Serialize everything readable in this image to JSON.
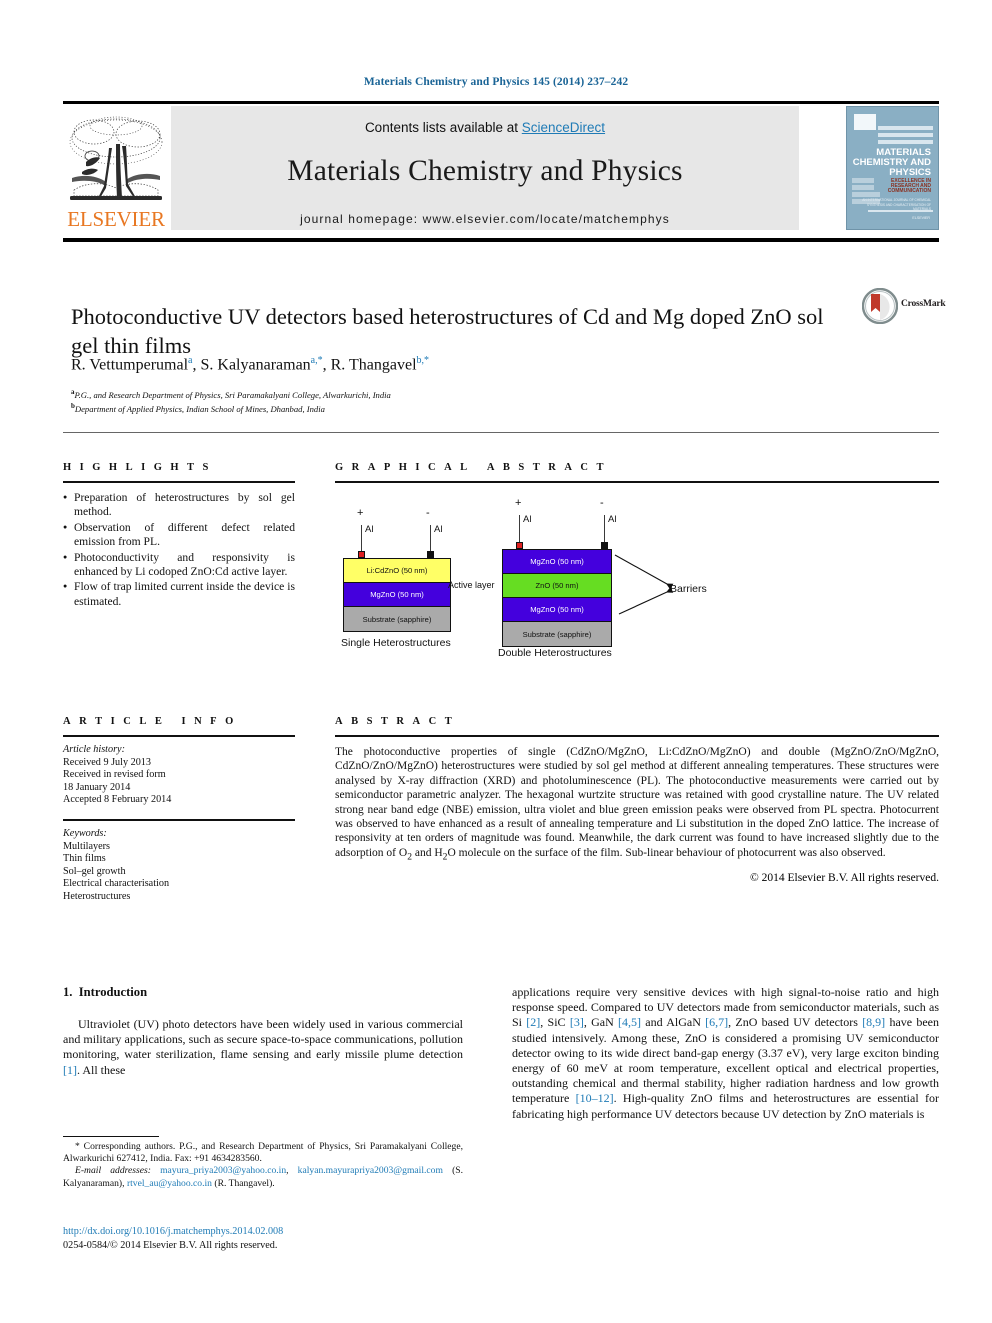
{
  "running_head": "Materials Chemistry and Physics 145 (2014) 237–242",
  "banner": {
    "contents_prefix": "Contents lists available at ",
    "sciencedirect": "ScienceDirect",
    "journal_title": "Materials Chemistry and Physics",
    "homepage": "journal homepage: www.elsevier.com/locate/matchemphys",
    "publisher_wordmark": "ELSEVIER",
    "cover": {
      "title_line1": "MATERIALS",
      "title_line2": "CHEMISTRY AND",
      "title_line3": "PHYSICS",
      "sub_line1": "EXCELLENCE IN",
      "sub_line2": "RESEARCH AND",
      "sub_line3": "COMMUNICATION",
      "tiny_line1": "AN INTERNATIONAL JOURNAL OF CHEMICAL",
      "tiny_line2": "SYNTHESIS AND CHARACTERISATION OF MATERIALS",
      "foot": "ELSEVIER"
    }
  },
  "article": {
    "title": "Photoconductive UV detectors based heterostructures of Cd and Mg doped ZnO sol gel thin films",
    "crossmark_label": "CrossMark",
    "authors": [
      {
        "name": "R. Vettumperumal",
        "marks": "a"
      },
      {
        "name": "S. Kalyanaraman",
        "marks": "a,*"
      },
      {
        "name": "R. Thangavel",
        "marks": "b,*"
      }
    ],
    "affiliations": [
      {
        "mark": "a",
        "text": "P.G., and Research Department of Physics, Sri Paramakalyani College, Alwarkurichi, India"
      },
      {
        "mark": "b",
        "text": "Department of Applied Physics, Indian School of Mines, Dhanbad, India"
      }
    ]
  },
  "highlights": {
    "heading": "HIGHLIGHTS",
    "items": [
      "Preparation of heterostructures by sol gel method.",
      "Observation of different defect related emission from PL.",
      "Photoconductivity and responsivity is enhanced by Li codoped ZnO:Cd active layer.",
      "Flow of trap limited current inside the device is estimated."
    ]
  },
  "graphical_abstract": {
    "heading": "GRAPHICAL ABSTRACT",
    "single": {
      "caption": "Single Heterostructures",
      "plus": "+",
      "minus": "-",
      "electrode_label": "Al",
      "layers": [
        {
          "label": "Li:CdZnO (50 nm)",
          "color": "#ffff66"
        },
        {
          "label": "MgZnO (50 nm)",
          "color": "#4400dd"
        },
        {
          "label": "Substrate (sapphire)",
          "color": "#aaaaaa"
        }
      ]
    },
    "double": {
      "caption": "Double Heterostructures",
      "plus": "+",
      "minus": "-",
      "electrode_label": "Al",
      "active_layer_label": "Active layer",
      "barriers_label": "Barriers",
      "layers": [
        {
          "label": "MgZnO (50 nm)",
          "color": "#4400dd"
        },
        {
          "label": "ZnO (50 nm)",
          "color": "#66dd22"
        },
        {
          "label": "MgZnO (50 nm)",
          "color": "#4400dd"
        },
        {
          "label": "Substrate (sapphire)",
          "color": "#aaaaaa"
        }
      ]
    }
  },
  "article_info": {
    "heading": "ARTICLE INFO",
    "history_label": "Article history:",
    "history": [
      "Received 9 July 2013",
      "Received in revised form",
      "18 January 2014",
      "Accepted 8 February 2014"
    ],
    "keywords_label": "Keywords:",
    "keywords": [
      "Multilayers",
      "Thin films",
      "Sol–gel growth",
      "Electrical characterisation",
      "Heterostructures"
    ]
  },
  "abstract": {
    "heading": "ABSTRACT",
    "text": "The photoconductive properties of single (CdZnO/MgZnO, Li:CdZnO/MgZnO) and double (MgZnO/ZnO/MgZnO, CdZnO/ZnO/MgZnO) heterostructures were studied by sol gel method at different annealing temperatures. These structures were analysed by X-ray diffraction (XRD) and photoluminescence (PL). The photoconductive measurements were carried out by semiconductor parametric analyzer. The hexagonal wurtzite structure was retained with good crystalline nature. The UV related strong near band edge (NBE) emission, ultra violet and blue green emission peaks were observed from PL spectra. Photocurrent was observed to have enhanced as a result of annealing temperature and Li substitution in the doped ZnO lattice. The increase of responsivity at ten orders of magnitude was found. Meanwhile, the dark current was found to have increased slightly due to the adsorption of O2 and H2O molecule on the surface of the film. Sub-linear behaviour of photocurrent was also observed.",
    "copyright": "© 2014 Elsevier B.V. All rights reserved."
  },
  "body": {
    "section_number": "1.",
    "section_title": "Introduction",
    "left_paragraph": "Ultraviolet (UV) photo detectors have been widely used in various commercial and military applications, such as secure space-to-space communications, pollution monitoring, water sterilization, flame sensing and early missile plume detection [1]. All these",
    "right_paragraph": "applications require very sensitive devices with high signal-to-noise ratio and high response speed. Compared to UV detectors made from semiconductor materials, such as Si [2], SiC [3], GaN [4,5] and AlGaN [6,7], ZnO based UV detectors [8,9] have been studied intensively. Among these, ZnO is considered a promising UV semiconductor detector owing to its wide direct band-gap energy (3.37 eV), very large exciton binding energy of 60 meV at room temperature, excellent optical and electrical properties, outstanding chemical and thermal stability, higher radiation hardness and low growth temperature [10–12]. High-quality ZnO films and heterostructures are essential for fabricating high performance UV detectors because UV detection by ZnO materials is"
  },
  "footnote": {
    "corresponding": "* Corresponding authors. P.G., and Research Department of Physics, Sri Paramakalyani College, Alwarkurichi 627412, India. Fax: +91 4634283560.",
    "email_label": "E-mail addresses:",
    "email1": "mayura_priya2003@yahoo.co.in",
    "email2": "kalyan.mayurapriya2003@gmail.com",
    "email2_owner": "(S. Kalyanaraman),",
    "email3": "rtvel_au@yahoo.co.in",
    "email3_owner": "(R. Thangavel)."
  },
  "doi_block": {
    "doi": "http://dx.doi.org/10.1016/j.matchemphys.2014.02.008",
    "issn_line": "0254-0584/© 2014 Elsevier B.V. All rights reserved."
  },
  "colors": {
    "link": "#1f7bb6",
    "elsevier_orange": "#E87722",
    "banner_grey": "#e7e7e7"
  }
}
